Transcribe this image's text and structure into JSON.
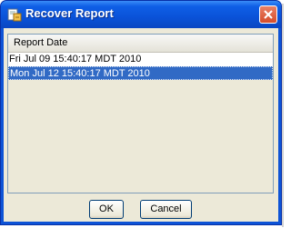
{
  "window": {
    "title": "Recover Report"
  },
  "list": {
    "column_header": "Report Date",
    "rows": [
      {
        "label": "Fri Jul 09 15:40:17 MDT 2010"
      },
      {
        "label": "Mon Jul 12 15:40:17 MDT 2010"
      }
    ]
  },
  "buttons": {
    "ok_label": "OK",
    "cancel_label": "Cancel"
  },
  "colors": {
    "title_bar": "#0a52d8",
    "selection": "#316ac5",
    "close": "#d54c2a"
  },
  "icons": {
    "app": "report-document-icon",
    "close": "close-icon"
  }
}
